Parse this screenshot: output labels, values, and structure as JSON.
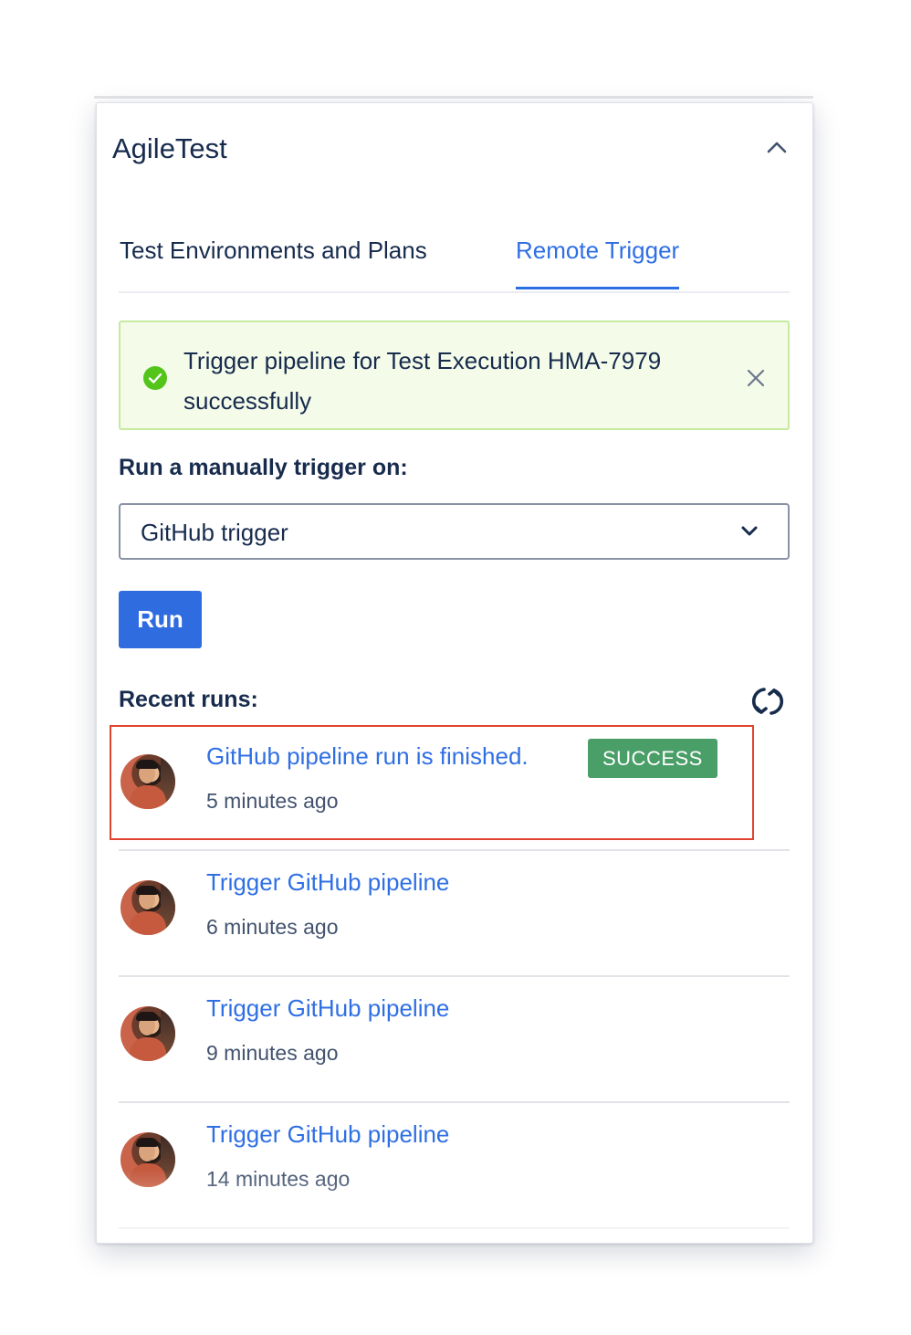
{
  "app": {
    "title": "AgileTest"
  },
  "tabs": [
    {
      "label": "Test Environments and Plans",
      "active": false
    },
    {
      "label": "Remote Trigger",
      "active": true
    }
  ],
  "alert": {
    "message": "Trigger pipeline for Test Execution HMA-7979 successfully",
    "status": "success"
  },
  "trigger": {
    "label": "Run a manually trigger on:",
    "selected": "GitHub trigger",
    "run_label": "Run"
  },
  "recent": {
    "label": "Recent runs:",
    "items": [
      {
        "title": "GitHub pipeline run is finished.",
        "badge": "SUCCESS",
        "time": "5 minutes ago"
      },
      {
        "title": "Trigger GitHub pipeline",
        "badge": "",
        "time": "6 minutes ago"
      },
      {
        "title": "Trigger GitHub pipeline",
        "badge": "",
        "time": "9 minutes ago"
      },
      {
        "title": "Trigger GitHub pipeline",
        "badge": "",
        "time": "14 minutes ago"
      }
    ]
  },
  "colors": {
    "accent": "#2f6fe4",
    "success_badge": "#4a9e68",
    "alert_bg": "#f4fbe9",
    "highlight": "#e0432e"
  },
  "icons": [
    "chevron-up-icon",
    "check-circle-icon",
    "close-icon",
    "chevron-down-icon",
    "refresh-icon"
  ]
}
